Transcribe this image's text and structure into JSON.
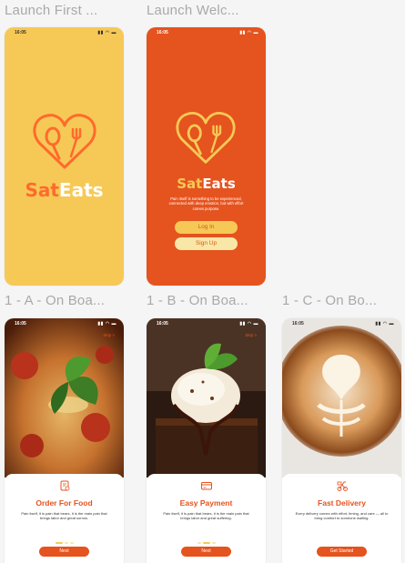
{
  "frames": {
    "launch_first": {
      "label": "Launch First ...",
      "time": "16:05",
      "brand_a": "Sat",
      "brand_b": "Eats"
    },
    "launch_welcome": {
      "label": "Launch Welc...",
      "time": "16:05",
      "brand_a": "Sat",
      "brand_b": "Eats",
      "tagline": "Pain itself is something to be experienced, connected with deep emotion, but with effort comes purpose.",
      "login_label": "Log In",
      "signup_label": "Sign Up"
    },
    "onboard_a": {
      "label": "1 - A - On Boa...",
      "time": "16:05",
      "skip_label": "Skip >",
      "icon": "order-icon",
      "title": "Order For Food",
      "description": "Pain itself, it is pain that bears, it is the main pain that brings labor and great sorrow.",
      "button_label": "Next",
      "active_dot": 0
    },
    "onboard_b": {
      "label": "1 - B - On Boa...",
      "time": "16:05",
      "skip_label": "Skip >",
      "icon": "card-icon",
      "title": "Easy Payment",
      "description": "Pain itself, it is pain that bears, it is the main pain that brings labor and great suffering.",
      "button_label": "Next",
      "active_dot": 1
    },
    "onboard_c": {
      "label": "1 - C - On Bo...",
      "time": "16:05",
      "icon": "delivery-icon",
      "title": "Fast Delivery",
      "description": "Every delivery comes with effort, timing, and care — all to bring comfort to someone waiting.",
      "button_label": "Get Started",
      "active_dot": 2
    }
  },
  "colors": {
    "yellow": "#f6c957",
    "orange": "#e5531e",
    "light_yellow": "#f9e7a8",
    "accent_orange": "#ff6a2c"
  }
}
